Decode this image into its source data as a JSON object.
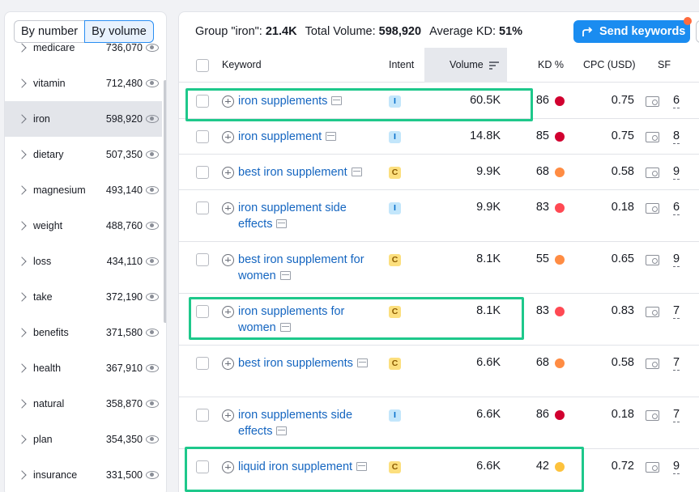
{
  "toggle": {
    "by_number": "By number",
    "by_volume": "By volume"
  },
  "groups": [
    {
      "name": "medicare",
      "count": "736,070"
    },
    {
      "name": "vitamin",
      "count": "712,480"
    },
    {
      "name": "iron",
      "count": "598,920",
      "selected": true
    },
    {
      "name": "dietary",
      "count": "507,350"
    },
    {
      "name": "magnesium",
      "count": "493,140"
    },
    {
      "name": "weight",
      "count": "488,760"
    },
    {
      "name": "loss",
      "count": "434,110"
    },
    {
      "name": "take",
      "count": "372,190"
    },
    {
      "name": "benefits",
      "count": "371,580"
    },
    {
      "name": "health",
      "count": "367,910"
    },
    {
      "name": "natural",
      "count": "358,870"
    },
    {
      "name": "plan",
      "count": "354,350"
    },
    {
      "name": "insurance",
      "count": "331,500"
    }
  ],
  "summary": {
    "group_label": "Group \"iron\": ",
    "group_value": "21.4K",
    "volume_label": "Total Volume: ",
    "volume_value": "598,920",
    "kd_label": "Average KD: ",
    "kd_value": "51%"
  },
  "send_button": "Send keywords",
  "columns": {
    "keyword": "Keyword",
    "intent": "Intent",
    "volume": "Volume",
    "kd": "KD %",
    "cpc": "CPC (USD)",
    "sf": "SF"
  },
  "rows": [
    {
      "keyword": "iron supplements",
      "intent": "I",
      "volume": "60.5K",
      "kd": "86",
      "kd_color": "#d1002f",
      "cpc": "0.75",
      "sf": "6"
    },
    {
      "keyword": "iron supplement",
      "intent": "I",
      "volume": "14.8K",
      "kd": "85",
      "kd_color": "#d1002f",
      "cpc": "0.75",
      "sf": "8"
    },
    {
      "keyword": "best iron supplement",
      "intent": "C",
      "volume": "9.9K",
      "kd": "68",
      "kd_color": "#ff8c43",
      "cpc": "0.58",
      "sf": "9"
    },
    {
      "keyword": "iron supplement side effects",
      "intent": "I",
      "volume": "9.9K",
      "kd": "83",
      "kd_color": "#ff4953",
      "cpc": "0.18",
      "sf": "6"
    },
    {
      "keyword": "best iron supplement for women",
      "intent": "C",
      "volume": "8.1K",
      "kd": "55",
      "kd_color": "#ff8c43",
      "cpc": "0.65",
      "sf": "9"
    },
    {
      "keyword": "iron supplements for women",
      "intent": "C",
      "volume": "8.1K",
      "kd": "83",
      "kd_color": "#ff4953",
      "cpc": "0.83",
      "sf": "7"
    },
    {
      "keyword": "best iron supplements",
      "intent": "C",
      "volume": "6.6K",
      "kd": "68",
      "kd_color": "#ff8c43",
      "cpc": "0.58",
      "sf": "7"
    },
    {
      "keyword": "iron supplements side effects",
      "intent": "I",
      "volume": "6.6K",
      "kd": "86",
      "kd_color": "#d1002f",
      "cpc": "0.18",
      "sf": "7"
    },
    {
      "keyword": "liquid iron supplement",
      "intent": "C",
      "volume": "6.6K",
      "kd": "42",
      "kd_color": "#fdc23c",
      "cpc": "0.72",
      "sf": "9"
    }
  ],
  "colors": {
    "accent": "#1a8cf0",
    "highlight": "#1ec88b",
    "link": "#1465c0"
  }
}
